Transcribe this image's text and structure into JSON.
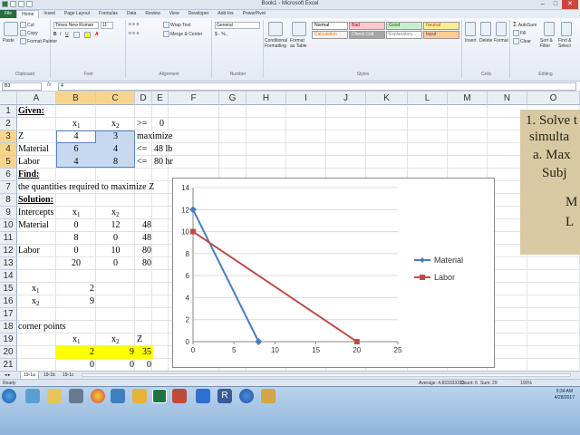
{
  "window": {
    "title": "Book1 - Microsoft Excel"
  },
  "ribbon": {
    "tabs": [
      "File",
      "Home",
      "Insert",
      "Page Layout",
      "Formulas",
      "Data",
      "Review",
      "View",
      "Developer",
      "Add-Ins",
      "PowerPivot"
    ],
    "active_tab": "Home",
    "clipboard": {
      "paste": "Paste",
      "cut": "Cut",
      "copy": "Copy",
      "format_painter": "Format Painter",
      "label": "Clipboard"
    },
    "font": {
      "name": "Times New Roman",
      "size": "11",
      "label": "Font"
    },
    "alignment": {
      "wrap": "Wrap Text",
      "merge": "Merge & Center",
      "label": "Alignment"
    },
    "number": {
      "format": "General",
      "label": "Number"
    },
    "styles": {
      "conditional": "Conditional Formatting",
      "format_table": "Format as Table",
      "cells": [
        {
          "label": "Normal",
          "bg": "#ffffff",
          "fg": "#000000"
        },
        {
          "label": "Bad",
          "bg": "#ffc7ce",
          "fg": "#9c0006"
        },
        {
          "label": "Good",
          "bg": "#c6efce",
          "fg": "#006100"
        },
        {
          "label": "Neutral",
          "bg": "#ffeb9c",
          "fg": "#9c5700"
        },
        {
          "label": "Calculation",
          "bg": "#f2f2f2",
          "fg": "#fa7d00"
        },
        {
          "label": "Check Cell",
          "bg": "#a5a5a5",
          "fg": "#ffffff"
        },
        {
          "label": "Explanatory...",
          "bg": "#ffffff",
          "fg": "#7f7f7f"
        },
        {
          "label": "Input",
          "bg": "#ffcc99",
          "fg": "#3f3f76"
        }
      ],
      "label": "Styles"
    },
    "cells_group": {
      "insert": "Insert",
      "delete": "Delete",
      "format": "Format",
      "label": "Cells"
    },
    "editing": {
      "autosum": "AutoSum",
      "fill": "Fill",
      "clear": "Clear",
      "sort": "Sort & Filter",
      "find": "Find & Select",
      "label": "Editing"
    }
  },
  "formula_bar": {
    "name_box": "B3",
    "fx": "fx",
    "value": "4"
  },
  "columns": [
    "A",
    "B",
    "C",
    "D",
    "E",
    "F",
    "G",
    "H",
    "I",
    "J",
    "K",
    "L",
    "M",
    "N",
    "O"
  ],
  "rows": [
    "1",
    "2",
    "3",
    "4",
    "5",
    "6",
    "7",
    "8",
    "9",
    "10",
    "11",
    "12",
    "13",
    "14",
    "15",
    "16",
    "17",
    "18",
    "19",
    "20",
    "21"
  ],
  "cells": {
    "a1": "Given:",
    "b2_x": "x",
    "b2_sub": "1",
    "c2_x": "x",
    "c2_sub": "2",
    "d2": ">=",
    "e2": "0",
    "a3": "Z",
    "b3": "4",
    "c3": "3",
    "d3": "maximize",
    "a4": "Material",
    "b4": "6",
    "c4": "4",
    "d4": "<=",
    "e4": "48 lb",
    "a5": "Labor",
    "b5": "4",
    "c5": "8",
    "d5": "<=",
    "e5": "80 hr",
    "a6": "Find:",
    "a7": "the quantities required to maximize Z",
    "a8": "Solution:",
    "a9": "Intercepts",
    "b9_x": "x",
    "b9_sub": "1",
    "c9_x": "x",
    "c9_sub": "2",
    "a10": "Material",
    "b10": "0",
    "c10": "12",
    "d10": "48",
    "b11": "8",
    "c11": "0",
    "d11": "48",
    "a12": "Labor",
    "b12": "0",
    "c12": "10",
    "d12": "80",
    "b13": "20",
    "c13": "0",
    "d13": "80",
    "a15_x": "x",
    "a15_sub": "1",
    "b15": "2",
    "a16_x": "x",
    "a16_sub": "2",
    "b16": "9",
    "a18": "corner points",
    "b19_x": "x",
    "b19_sub": "1",
    "c19_x": "x",
    "c19_sub": "2",
    "d19": "Z",
    "b20": "2",
    "c20": "9",
    "d20": "35",
    "b21": "0",
    "c21": "0",
    "d21": "0"
  },
  "chart_data": {
    "type": "line",
    "xlim": [
      0,
      25
    ],
    "ylim": [
      0,
      14
    ],
    "xticks": [
      "0",
      "5",
      "10",
      "15",
      "20",
      "25"
    ],
    "yticks": [
      "0",
      "2",
      "4",
      "6",
      "8",
      "10",
      "12",
      "14"
    ],
    "grid": true,
    "legend": "right",
    "series": [
      {
        "name": "Material",
        "color": "#4a7ebb",
        "x": [
          0,
          8
        ],
        "y": [
          12,
          0
        ]
      },
      {
        "name": "Labor",
        "color": "#be4b48",
        "x": [
          0,
          20
        ],
        "y": [
          10,
          0
        ]
      }
    ]
  },
  "book_image": {
    "lines": [
      "1.  Solve t",
      "simulta",
      "a.  Max",
      "Subj",
      "M",
      "L"
    ]
  },
  "sheet_tabs": [
    "19-1a",
    "19-1b",
    "19-1c"
  ],
  "status": {
    "ready": "Ready",
    "average": "Average: 4.833333333",
    "count": "Count: 6",
    "sum": "Sum: 29",
    "zoom": "100%"
  },
  "clock": {
    "time": "9:34 AM",
    "date": "4/28/2017"
  }
}
